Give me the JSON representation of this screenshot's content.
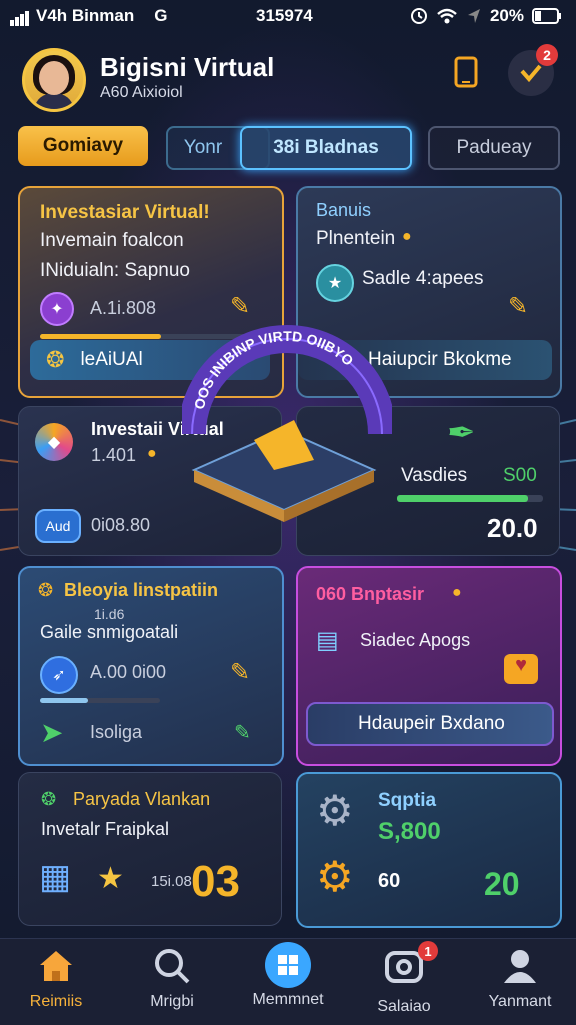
{
  "status_bar": {
    "carrier": "V4h Binman",
    "carrier_icon": "G",
    "time": "315974",
    "battery": "20%"
  },
  "header": {
    "title": "Bigisni Virtual",
    "subtitle": "A60 Aixioiol",
    "notif_count": "2"
  },
  "tabs": [
    {
      "label": "Gomiavy"
    },
    {
      "label": "Yonr"
    },
    {
      "label": "38i Bladnas"
    },
    {
      "label": "Padueay"
    }
  ],
  "cards": {
    "c1": {
      "title": "Investasiar Virtual!",
      "line1": "Invemain foalcon",
      "line2": "INiduialn: Sapnuo",
      "value": "A.1i.808",
      "pill": "leAiUAl"
    },
    "c2": {
      "title": "Banuis",
      "line1": "Plnentein",
      "item": "Sadle 4:apees",
      "pill": "Haiupcir Bkokme"
    },
    "c3": {
      "title": "Investaii Virtual",
      "value": "1.401",
      "chip": "Aud",
      "value2": "0i08.80"
    },
    "c4": {
      "label": "Vasdies",
      "label_value": "S00",
      "amount": "20.0"
    },
    "c5": {
      "title": "Bleoyia linstpatiin",
      "sub_value": "1i.d6",
      "line1": "Gaile snmigoatali",
      "value": "A.00 0i00",
      "item": "Isoliga"
    },
    "c6": {
      "title": "060 Bnptasir",
      "item": "Siadec Apogs",
      "pill": "Hdaupeir Bxdano"
    },
    "c7": {
      "title": "Paryada Vlankan",
      "line1": "Invetalr Fraipkal",
      "small": "15i.08",
      "big": "03"
    },
    "c8": {
      "title": "Sqptia",
      "value": "S,800",
      "value2": "60",
      "value3": "20"
    }
  },
  "center_art": {
    "arc_text": "OOS INIBINP VIRTD OIIBYO"
  },
  "nav": [
    {
      "label": "Reimiis",
      "icon": "home-icon"
    },
    {
      "label": "Mrigbi",
      "icon": "search-icon"
    },
    {
      "label": "Memmnet",
      "icon": "grid-icon"
    },
    {
      "label": "Salaiao",
      "icon": "camera-icon",
      "badge": "1"
    },
    {
      "label": "Yanmant",
      "icon": "user-icon"
    }
  ],
  "progress": {
    "c1": 0.55,
    "c4": 0.9,
    "c5": 0.4
  }
}
